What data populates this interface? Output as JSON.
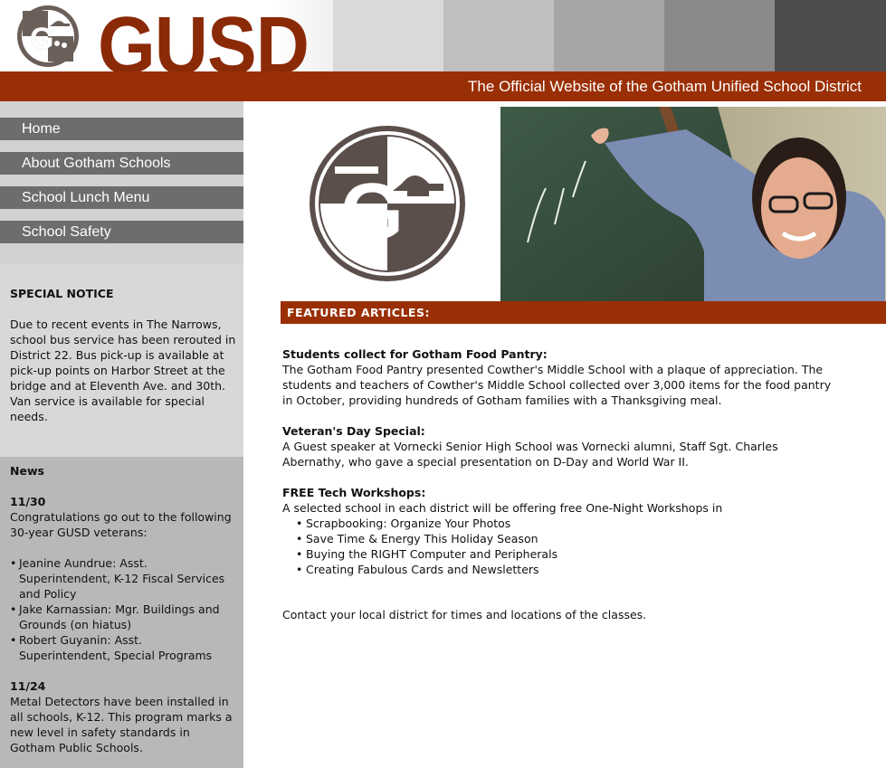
{
  "header": {
    "brand": "GUSD",
    "tagline": "The Official Website of the Gotham Unified School District",
    "band_colors": [
      "#d9d9d9",
      "#bfbfbf",
      "#a5a5a5",
      "#8a8a8a",
      "#6e6e6e",
      "#4d4d4d"
    ],
    "accent": "#9a2f05",
    "logo_icon": "gusd-seal-icon"
  },
  "nav": {
    "items": [
      {
        "label": "Home"
      },
      {
        "label": "About Gotham Schools"
      },
      {
        "label": "School Lunch Menu"
      },
      {
        "label": "School Safety"
      }
    ]
  },
  "notice": {
    "title": "SPECIAL NOTICE",
    "body": "Due to recent events in The Narrows, school bus service has been rerouted in District 22. Bus pick-up is available at pick-up points on Harbor Street at the bridge and at Eleventh Ave. and 30th. Van service is available for special needs."
  },
  "news": {
    "title": "News",
    "items": [
      {
        "date": "11/30",
        "text": "Congratulations go out to the following 30-year GUSD veterans:",
        "bullets": [
          "Jeanine Aundrue: Asst. Superintendent, K-12 Fiscal Services and Policy",
          "Jake Karnassian: Mgr. Buildings and Grounds (on hiatus)",
          "Robert Guyanin: Asst. Superintendent, Special Programs"
        ]
      },
      {
        "date": "11/24",
        "text": "Metal Detectors have been installed in all schools, K-12. This program marks a new level in safety standards in Gotham Public Schools."
      }
    ]
  },
  "main": {
    "featured_label": "FEATURED ARTICLES:",
    "articles": [
      {
        "title": "Students collect for Gotham Food Pantry:",
        "body": "The Gotham Food Pantry presented Cowther's Middle School with a plaque of appreciation. The students and teachers of Cowther's Middle School collected over 3,000 items for the food pantry in October, providing hundreds of Gotham families with a Thanksgiving meal."
      },
      {
        "title": "Veteran's Day Special:",
        "body": "A Guest speaker at Vornecki Senior High School was Vornecki alumni, Staff Sgt. Charles Abernathy, who gave a special presentation on D-Day and World War II."
      },
      {
        "title": "FREE Tech Workshops:",
        "body": "A selected school in each district will be offering free One-Night Workshops in",
        "list": [
          "Scrapbooking: Organize Your Photos",
          "Save Time & Energy This Holiday Season",
          "Buying the RIGHT Computer and Peripherals",
          "Creating Fabulous Cards and Newsletters"
        ]
      }
    ],
    "contact": "Contact your local district for times and locations of the classes.",
    "photo_icon": "teacher-photo"
  }
}
